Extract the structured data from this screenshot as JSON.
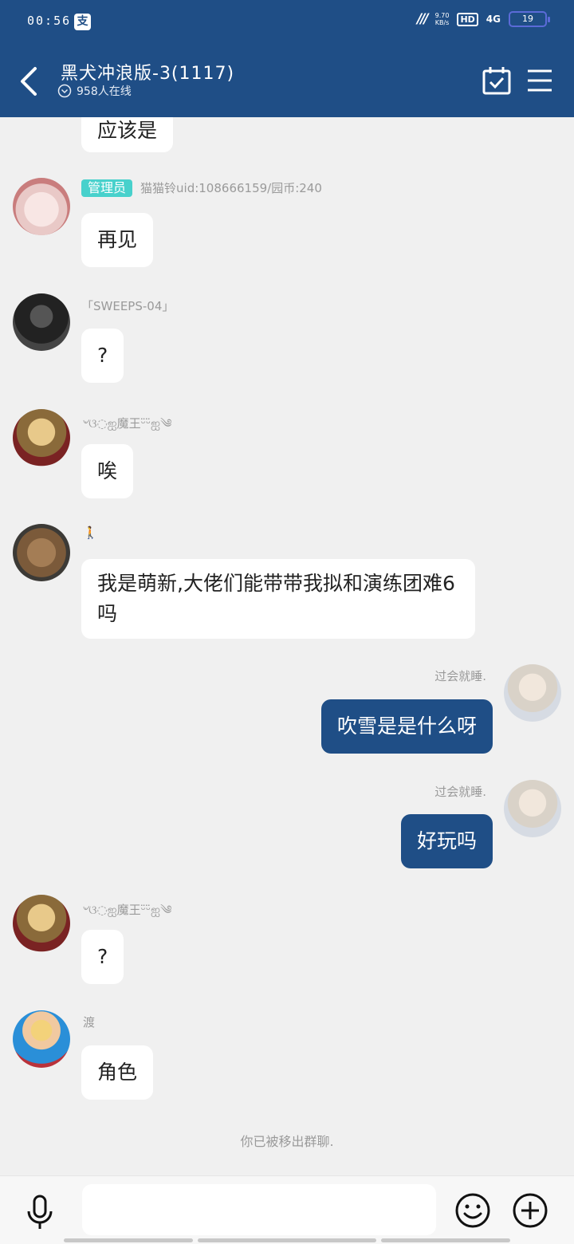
{
  "status_bar": {
    "time": "00:56",
    "pay_glyph": "支",
    "speed_value": "9.70",
    "speed_unit": "KB/s",
    "hd": "HD",
    "network": "4G",
    "battery": "19"
  },
  "header": {
    "title": "黑犬冲浪版-3(1117)",
    "online": "958人在线"
  },
  "messages": [
    {
      "sender": "",
      "text": "应该是"
    },
    {
      "badge": "管理员",
      "sender": "猫猫铃uid:108666159/园币:240",
      "text": "再见"
    },
    {
      "sender": "「SWEEPS-04」",
      "text": "?"
    },
    {
      "sender": "৺ଓ◌ஐ魔王ᵕ̈ᵕ̈ஐ༄",
      "text": "唉"
    },
    {
      "sender": "🚶",
      "text": "我是萌新,大佬们能带带我拟和演练团难6吗"
    },
    {
      "sender": "过会就睡.",
      "text": "吹雪是是什么呀"
    },
    {
      "sender": "过会就睡.",
      "text": "好玩吗"
    },
    {
      "sender": "৺ଓ◌ஐ魔王ᵕ̈ᵕ̈ஐ༄",
      "text": "?"
    },
    {
      "sender": "渡",
      "text": "角色"
    }
  ],
  "notice": "你已被移出群聊.",
  "input": {
    "placeholder": ""
  },
  "colors": {
    "header": "#1f4e86",
    "my_bubble": "#1f4e86",
    "admin_badge": "#48d1cc"
  },
  "icons": [
    "back-arrow-icon",
    "calendar-check-icon",
    "menu-icon",
    "microphone-icon",
    "emoji-icon",
    "plus-icon"
  ]
}
